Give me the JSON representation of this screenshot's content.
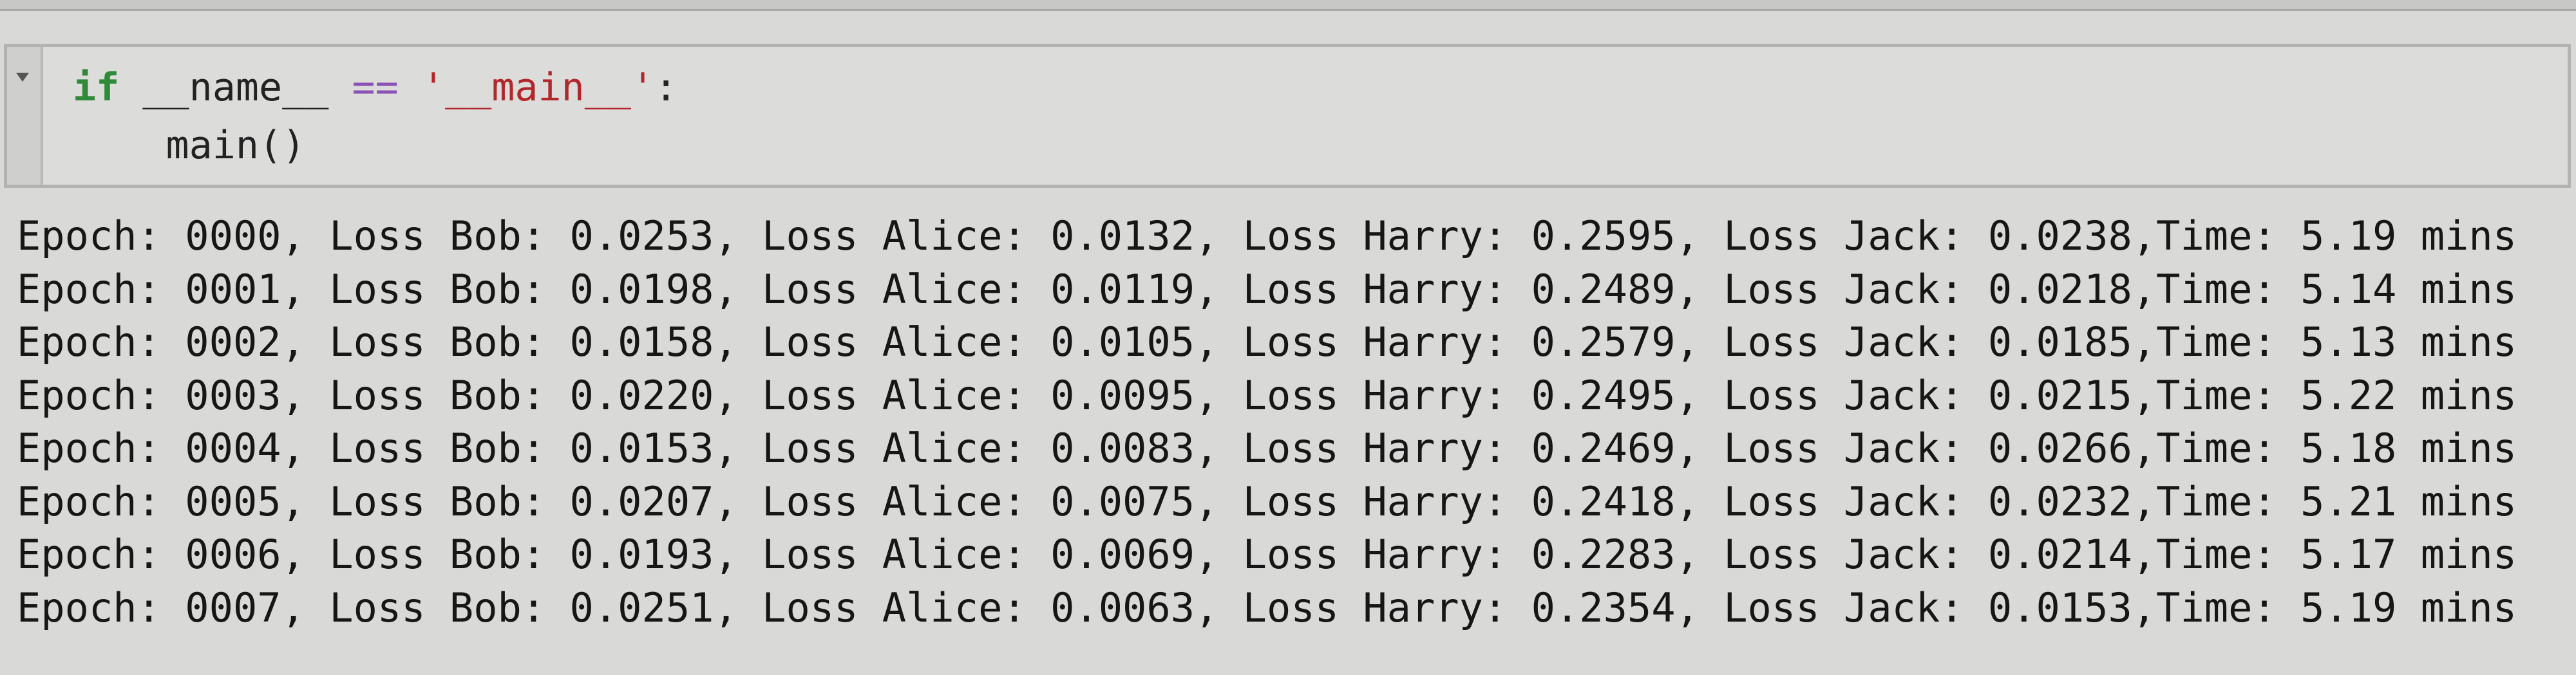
{
  "code_cell": {
    "line1": {
      "kw": "if",
      "ident": "__name__",
      "op": "==",
      "str": "'__main__'",
      "end": ":"
    },
    "line2": "main()"
  },
  "output_lines": [
    "Epoch: 0000, Loss Bob: 0.0253, Loss Alice: 0.0132, Loss Harry: 0.2595, Loss Jack: 0.0238,Time: 5.19 mins",
    "Epoch: 0001, Loss Bob: 0.0198, Loss Alice: 0.0119, Loss Harry: 0.2489, Loss Jack: 0.0218,Time: 5.14 mins",
    "Epoch: 0002, Loss Bob: 0.0158, Loss Alice: 0.0105, Loss Harry: 0.2579, Loss Jack: 0.0185,Time: 5.13 mins",
    "Epoch: 0003, Loss Bob: 0.0220, Loss Alice: 0.0095, Loss Harry: 0.2495, Loss Jack: 0.0215,Time: 5.22 mins",
    "Epoch: 0004, Loss Bob: 0.0153, Loss Alice: 0.0083, Loss Harry: 0.2469, Loss Jack: 0.0266,Time: 5.18 mins",
    "Epoch: 0005, Loss Bob: 0.0207, Loss Alice: 0.0075, Loss Harry: 0.2418, Loss Jack: 0.0232,Time: 5.21 mins",
    "Epoch: 0006, Loss Bob: 0.0193, Loss Alice: 0.0069, Loss Harry: 0.2283, Loss Jack: 0.0214,Time: 5.17 mins",
    "Epoch: 0007, Loss Bob: 0.0251, Loss Alice: 0.0063, Loss Harry: 0.2354, Loss Jack: 0.0153,Time: 5.19 mins"
  ]
}
